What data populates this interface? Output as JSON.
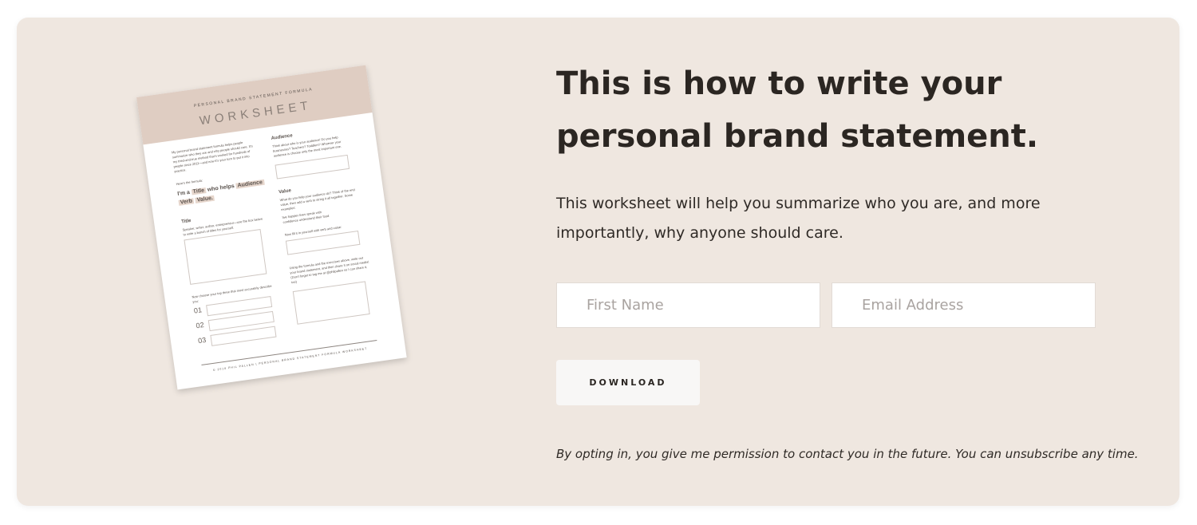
{
  "worksheet": {
    "kicker": "Personal Brand Statement Formula",
    "title": "WORKSHEET",
    "intro": "My personal brand statement formula helps people summarize who they are and why people should care. It's my tried-and-true method that's worked for hundreds of people since 2011—and now it's your turn to put it into practice.",
    "here_formula": "Here's the formula:",
    "formula_prefix": "I'm a",
    "formula_title": "Title",
    "formula_mid": "who helps",
    "formula_audience": "Audience",
    "formula_verb": "Verb",
    "formula_value": "Value.",
    "title_heading": "Title",
    "title_text": "Speaker, writer, author, entrepreneur—use the box below to write a bunch of titles for yourself.",
    "choose_text": "Now choose your top three that most accurately describe you:",
    "num1": "01",
    "num2": "02",
    "num3": "03",
    "audience_heading": "Audience",
    "audience_text": "Think about who is your audience! Do you help businesses? Teachers? Toddlers? Whoever your audience is choose only the most important one.",
    "value_heading": "Value",
    "value_text": "What do you help your audience do? Think of the end value, then add a verb to string it all together. Some examples:",
    "examples": "live happier lives  speak with confidence  understand their food",
    "fill_text": "Now fill it in yourself with verb and value:",
    "using_text": "Using the formula and the exercises above, write out your brand statement, and then share it on social media! (Don't forget to tag me at @philpallen so I can share it, too)",
    "footer": "© 2018 Phil Pallen | Personal Brand Statement Formula Worksheet"
  },
  "headline_line1": "This is how to write your",
  "headline_line2": "personal brand statement.",
  "description_line1": "This worksheet will help you summarize who you are, and more",
  "description_line2": "importantly, why anyone should care.",
  "form": {
    "first_name_placeholder": "First Name",
    "email_placeholder": "Email Address",
    "download_label": "DOWNLOAD"
  },
  "consent": "By opting in, you give me permission to contact you in the future. You can unsubscribe any time.",
  "colors": {
    "card_bg": "#efe7e0",
    "sheet_header": "#dfcdc2",
    "text": "#2b2622"
  }
}
